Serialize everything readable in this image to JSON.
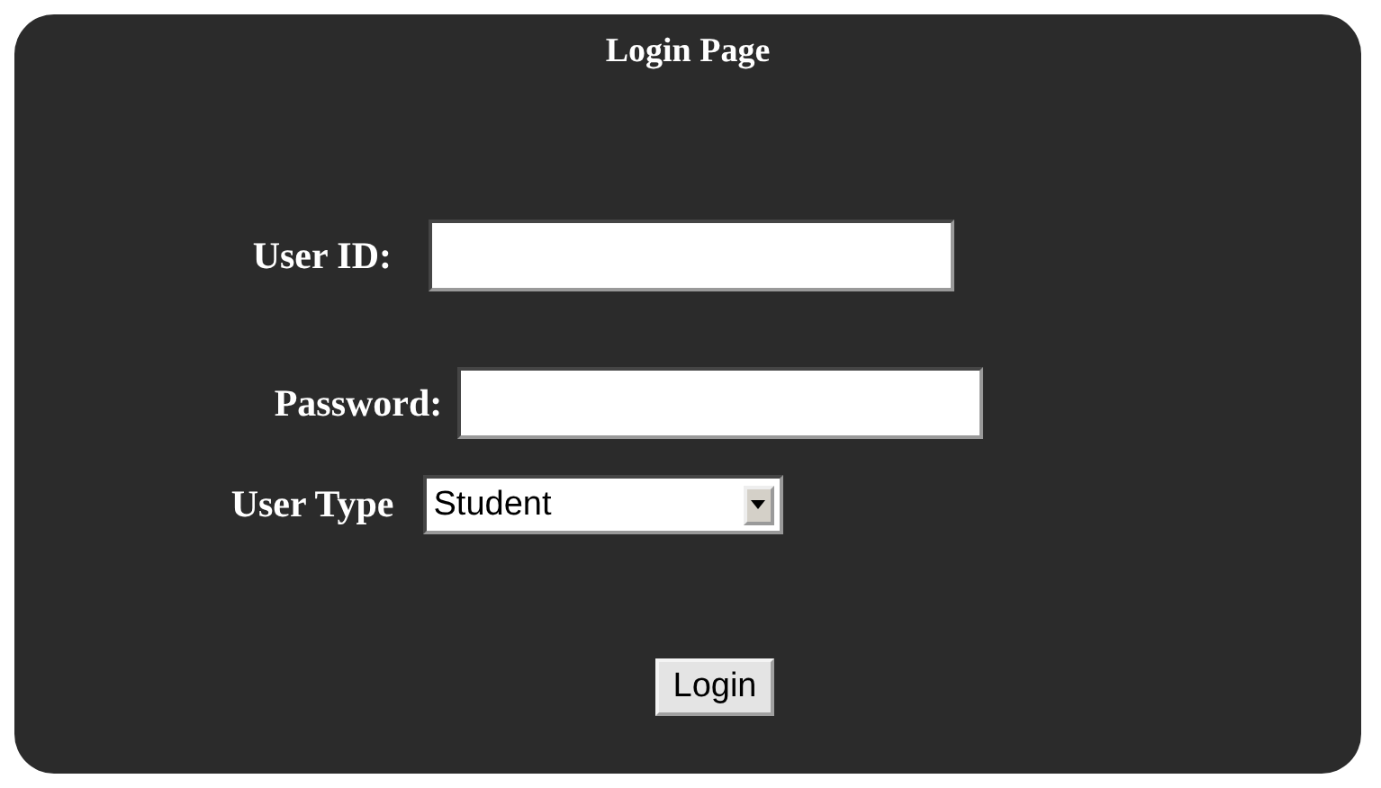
{
  "title": "Login Page",
  "fields": [
    {
      "kind": "text",
      "label": "User ID:"
    },
    {
      "kind": "password",
      "label": "Password:"
    },
    {
      "kind": "select",
      "label": "User Type",
      "value": "Student"
    }
  ],
  "button": "Login"
}
